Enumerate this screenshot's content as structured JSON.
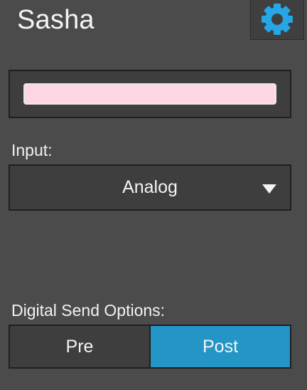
{
  "header": {
    "title": "Sasha",
    "settings_icon": "gear-icon"
  },
  "color": {
    "swatch": "#ffd6e6"
  },
  "input": {
    "label": "Input:",
    "selected": "Analog",
    "arrow_icon": "triangle-down-icon"
  },
  "digital_send": {
    "label": "Digital Send Options:",
    "options": [
      "Pre",
      "Post"
    ],
    "selected": "Post",
    "accent": "#2395c6"
  }
}
